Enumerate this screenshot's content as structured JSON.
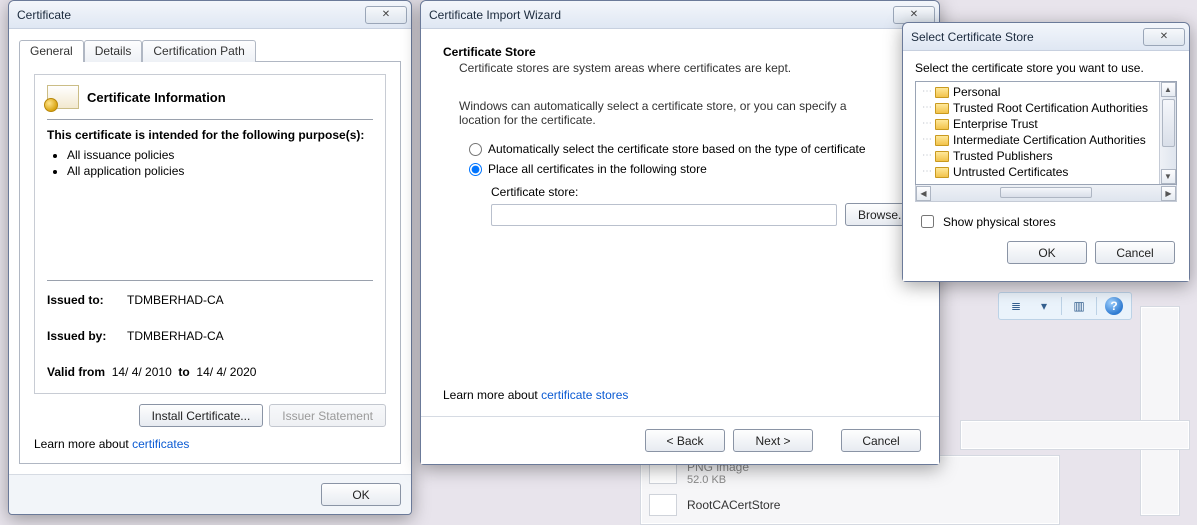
{
  "cert_dialog": {
    "title": "Certificate",
    "tabs": {
      "general": "General",
      "details": "Details",
      "path": "Certification Path"
    },
    "heading": "Certificate Information",
    "purpose_title": "This certificate is intended for the following purpose(s):",
    "purposes": [
      "All issuance policies",
      "All application policies"
    ],
    "issued_to_label": "Issued to:",
    "issued_to": "TDMBERHAD-CA",
    "issued_by_label": "Issued by:",
    "issued_by": "TDMBERHAD-CA",
    "valid_from_label": "Valid from",
    "valid_from": "14/ 4/ 2010",
    "valid_to_label": "to",
    "valid_to": "14/ 4/ 2020",
    "install_btn": "Install Certificate...",
    "issuer_btn": "Issuer Statement",
    "learn_prefix": "Learn more about ",
    "learn_link": "certificates",
    "ok": "OK"
  },
  "wizard": {
    "title": "Certificate Import Wizard",
    "section": "Certificate Store",
    "section_sub": "Certificate stores are system areas where certificates are kept.",
    "text1": "Windows can automatically select a certificate store, or you can specify a location for the certificate.",
    "opt_auto": "Automatically select the certificate store based on the type of certificate",
    "opt_place": "Place all certificates in the following store",
    "store_label": "Certificate store:",
    "browse": "Browse...",
    "learn_prefix": "Learn more about ",
    "learn_link": "certificate stores",
    "back": "< Back",
    "next": "Next >",
    "cancel": "Cancel"
  },
  "select_store": {
    "title": "Select Certificate Store",
    "prompt": "Select the certificate store you want to use.",
    "items": [
      "Personal",
      "Trusted Root Certification Authorities",
      "Enterprise Trust",
      "Intermediate Certification Authorities",
      "Trusted Publishers",
      "Untrusted Certificates"
    ],
    "show_physical": "Show physical stores",
    "ok": "OK",
    "cancel": "Cancel"
  },
  "background": {
    "file1_type": "PNG image",
    "file1_size": "52.0 KB",
    "file2_name": "RootCACertStore"
  }
}
